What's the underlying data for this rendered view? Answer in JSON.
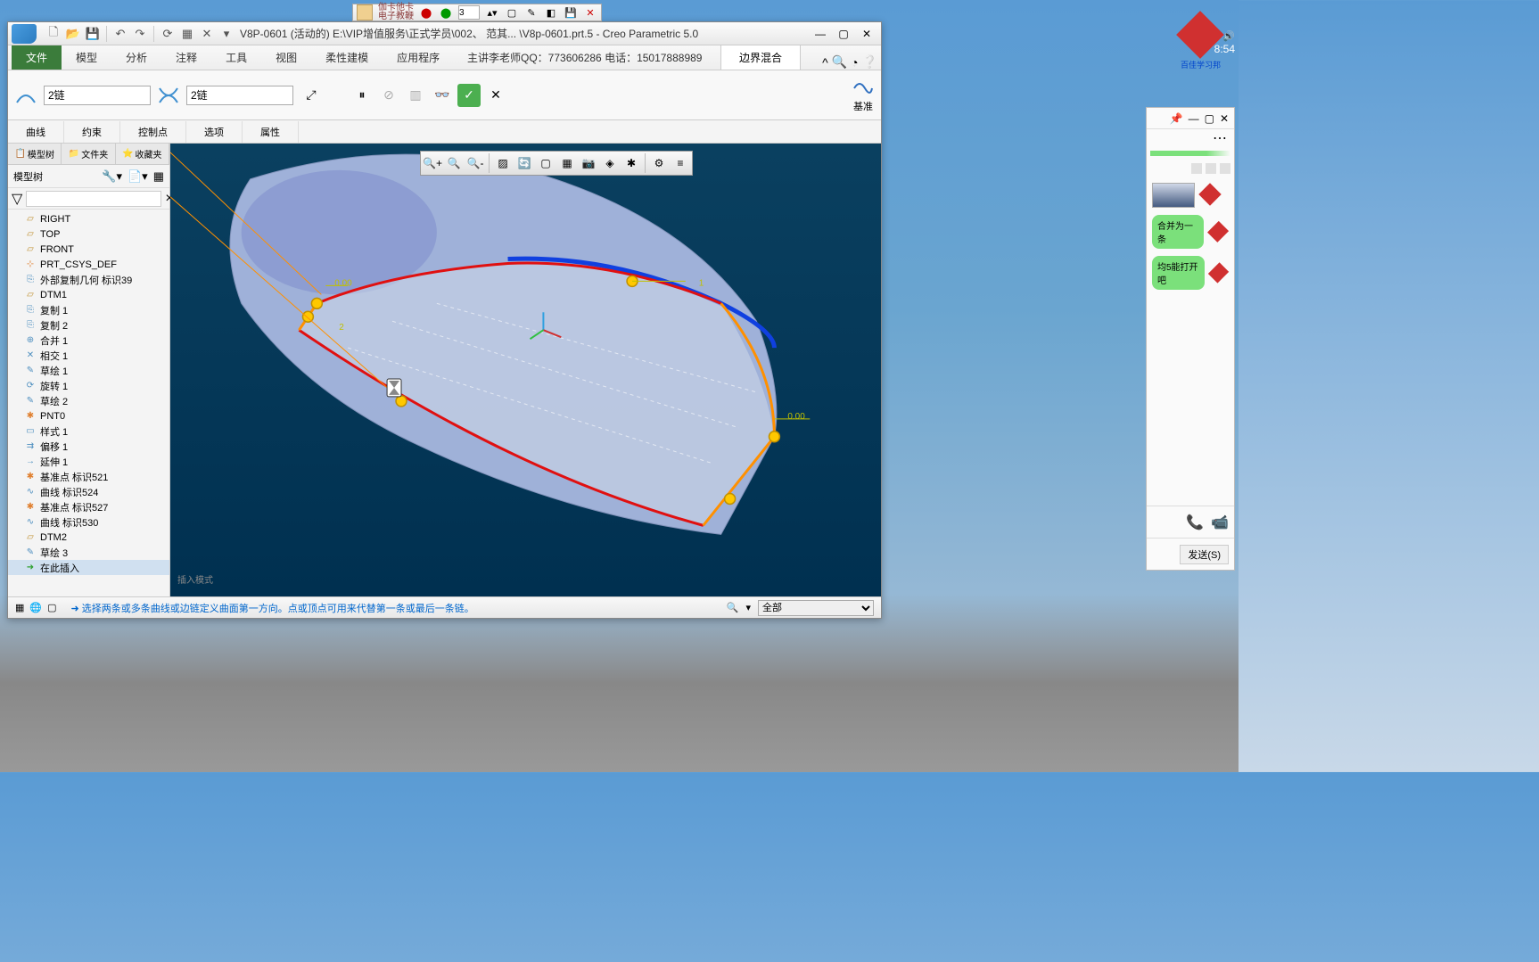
{
  "float_toolbar": {
    "text1": "伽卡他卡",
    "text2": "电子教鞭",
    "number_input": "3"
  },
  "window": {
    "title": "V8P-0601 (活动的) E:\\VIP增值服务\\正式学员\\002、 范其... \\V8p-0601.prt.5 - Creo Parametric 5.0"
  },
  "ribbon": {
    "file": "文件",
    "tabs": [
      "模型",
      "分析",
      "注释",
      "工具",
      "视图",
      "柔性建模",
      "应用程序"
    ],
    "info_text": "主讲李老师QQ：773606286 电话：15017888989",
    "active_context": "边界混合"
  },
  "boundary_blend": {
    "chain1_value": "2链",
    "chain2_value": "2链",
    "datum_label": "基准"
  },
  "sub_tabs": [
    "曲线",
    "约束",
    "控制点",
    "选项",
    "属性"
  ],
  "tree": {
    "tabs": [
      "模型树",
      "文件夹",
      "收藏夹"
    ],
    "header": "模型树",
    "items": [
      {
        "icon": "plane",
        "label": "RIGHT"
      },
      {
        "icon": "plane",
        "label": "TOP"
      },
      {
        "icon": "plane",
        "label": "FRONT"
      },
      {
        "icon": "csys",
        "label": "PRT_CSYS_DEF"
      },
      {
        "icon": "copy",
        "label": "外部复制几何 标识39"
      },
      {
        "icon": "plane",
        "label": "DTM1"
      },
      {
        "icon": "copy",
        "label": "复制 1"
      },
      {
        "icon": "copy",
        "label": "复制 2"
      },
      {
        "icon": "merge",
        "label": "合并 1"
      },
      {
        "icon": "intersect",
        "label": "相交 1"
      },
      {
        "icon": "sketch",
        "label": "草绘 1"
      },
      {
        "icon": "revolve",
        "label": "旋转 1"
      },
      {
        "icon": "sketch",
        "label": "草绘 2"
      },
      {
        "icon": "point",
        "label": "PNT0"
      },
      {
        "icon": "style",
        "label": "样式 1"
      },
      {
        "icon": "offset",
        "label": "偏移 1"
      },
      {
        "icon": "extend",
        "label": "延伸 1"
      },
      {
        "icon": "point",
        "label": "基准点 标识521"
      },
      {
        "icon": "curve",
        "label": "曲线 标识524"
      },
      {
        "icon": "point",
        "label": "基准点 标识527"
      },
      {
        "icon": "curve",
        "label": "曲线 标识530"
      },
      {
        "icon": "plane",
        "label": "DTM2"
      },
      {
        "icon": "sketch",
        "label": "草绘 3"
      },
      {
        "icon": "insert",
        "label": "在此插入",
        "selected": true
      }
    ]
  },
  "viewport": {
    "insert_mode": "插入模式",
    "label_0_00_a": "0.00",
    "label_0_00_b": "0.00",
    "label_1": "1",
    "label_2": "2"
  },
  "status": {
    "message": "选择两条或多条曲线或边链定义曲面第一方向。点或顶点可用来代替第一条或最后一条链。",
    "filter": "全部"
  },
  "chat": {
    "bubble1": "合并为一条",
    "bubble2": "均5能打开吧",
    "send": "发送(S)"
  },
  "desktop": {
    "icon_text": "百佳学习邦",
    "clock": "8:54"
  }
}
